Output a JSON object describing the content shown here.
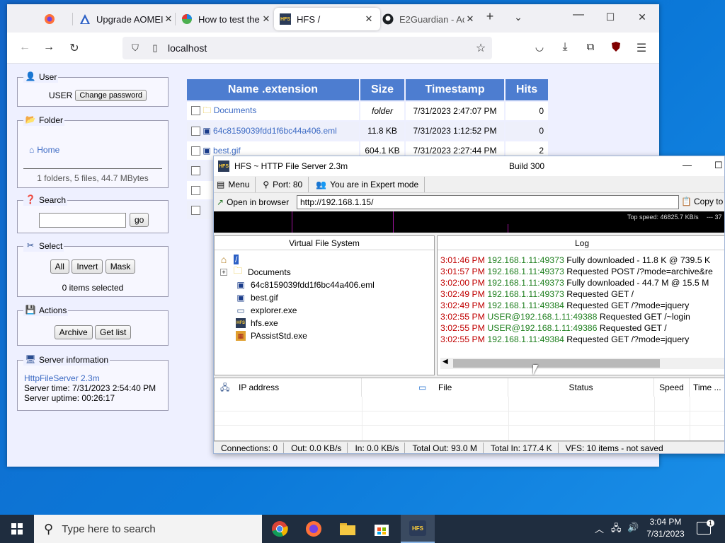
{
  "browser": {
    "tabs": [
      {
        "label": "Upgrade AOMEI",
        "icon": "aomei-icon"
      },
      {
        "label": "How to test the",
        "icon": "colorful-icon"
      },
      {
        "label": "HFS /",
        "icon": "hfs-icon",
        "active": true
      },
      {
        "label": "E2Guardian - Ac",
        "icon": "github-icon"
      }
    ],
    "url": "localhost"
  },
  "hfs_page": {
    "user": {
      "legend": "User",
      "name": "USER",
      "change_password": "Change password"
    },
    "folder": {
      "legend": "Folder",
      "home": "Home",
      "summary": "1 folders, 5 files, 44.7 MBytes"
    },
    "search": {
      "legend": "Search",
      "go": "go"
    },
    "select": {
      "legend": "Select",
      "all": "All",
      "invert": "Invert",
      "mask": "Mask",
      "status": "0 items selected"
    },
    "actions": {
      "legend": "Actions",
      "archive": "Archive",
      "get_list": "Get list"
    },
    "server": {
      "legend": "Server information",
      "link": "HttpFileServer 2.3m",
      "time": "Server time: 7/31/2023 2:54:40 PM",
      "uptime": "Server uptime: 00:26:17"
    },
    "table": {
      "headers": [
        "Name .extension",
        "Size",
        "Timestamp",
        "Hits"
      ],
      "rows": [
        {
          "name": "Documents",
          "size": "folder",
          "time": "7/31/2023 2:47:07 PM",
          "hits": "0"
        },
        {
          "name": "64c8159039fdd1f6bc44a406.eml",
          "size": "11.8 KB",
          "time": "7/31/2023 1:12:52 PM",
          "hits": "0"
        },
        {
          "name": "best.gif",
          "size": "604.1 KB",
          "time": "7/31/2023 2:27:44 PM",
          "hits": "2"
        }
      ]
    }
  },
  "hfs_window": {
    "title": "HFS ~ HTTP File Server 2.3m",
    "build": "Build 300",
    "toolbar": {
      "menu": "Menu",
      "port": "Port: 80",
      "mode": "You are in Expert mode"
    },
    "open_browser": "Open in browser",
    "url": "http://192.168.1.15/",
    "copy": "Copy to",
    "graph": {
      "top_speed": "Top speed: 46825.7 KB/s",
      "tail": "---  37"
    },
    "vfs": {
      "header": "Virtual File System",
      "root": "/",
      "items": [
        "Documents",
        "64c8159039fdd1f6bc44a406.eml",
        "best.gif",
        "explorer.exe",
        "hfs.exe",
        "PAssistStd.exe"
      ]
    },
    "log": {
      "header": "Log",
      "lines": [
        {
          "time": "3:01:46 PM",
          "ip": "192.168.1.11:49373",
          "msg": "Fully downloaded - 11.8 K @ 739.5 K"
        },
        {
          "time": "3:01:57 PM",
          "ip": "192.168.1.11:49373",
          "msg": "Requested POST /?mode=archive&re"
        },
        {
          "time": "3:02:00 PM",
          "ip": "192.168.1.11:49373",
          "msg": "Fully downloaded - 44.7 M @ 15.5 M"
        },
        {
          "time": "3:02:49 PM",
          "ip": "192.168.1.11:49373",
          "msg": "Requested GET /"
        },
        {
          "time": "3:02:49 PM",
          "ip": "192.168.1.11:49384",
          "msg": "Requested GET /?mode=jquery"
        },
        {
          "time": "3:02:55 PM",
          "ip": "USER@192.168.1.11:49388",
          "msg": "Requested GET /~login"
        },
        {
          "time": "3:02:55 PM",
          "ip": "USER@192.168.1.11:49386",
          "msg": "Requested GET /"
        },
        {
          "time": "3:02:55 PM",
          "ip": "192.168.1.11:49384",
          "msg": "Requested GET /?mode=jquery"
        }
      ]
    },
    "connections": {
      "headers": [
        "IP address",
        "File",
        "Status",
        "Speed",
        "Time ..."
      ]
    },
    "status": [
      "Connections: 0",
      "Out: 0.0 KB/s",
      "In: 0.0 KB/s",
      "Total Out: 93.0 M",
      "Total In: 177.4 K",
      "VFS: 10 items - not saved"
    ]
  },
  "taskbar": {
    "search_placeholder": "Type here to search",
    "time": "3:04 PM",
    "date": "7/31/2023",
    "notifications": "1"
  }
}
